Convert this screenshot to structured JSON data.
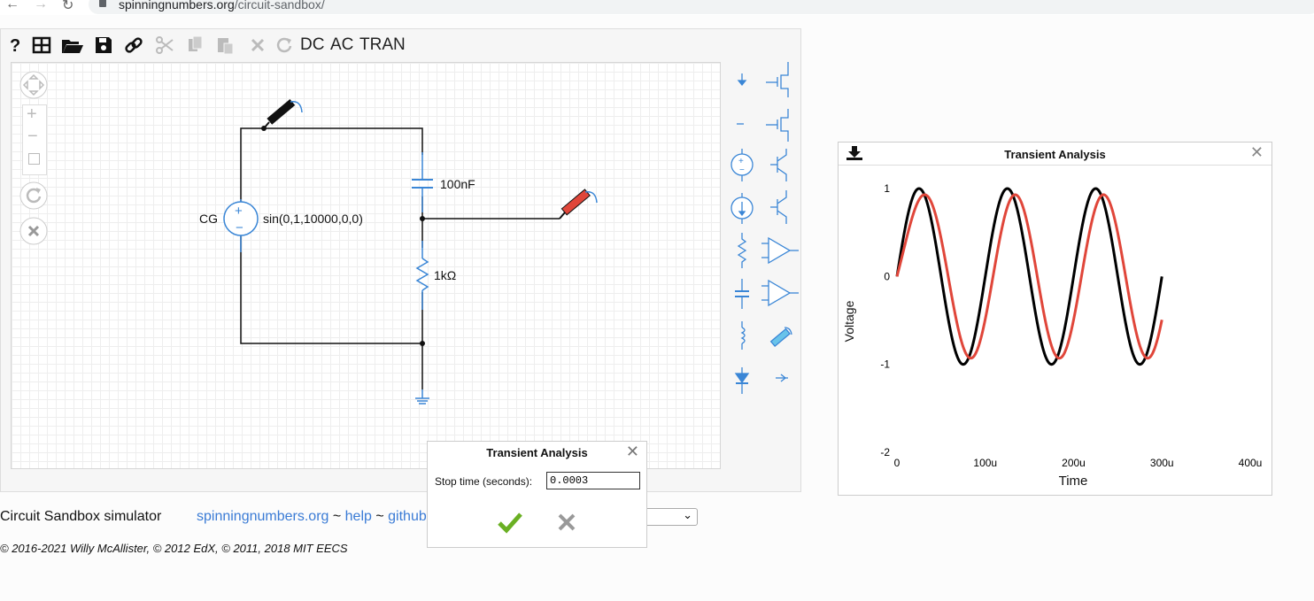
{
  "browser": {
    "url_host": "spinningnumbers.org",
    "url_path": "/circuit-sandbox/"
  },
  "toolbar": {
    "icons": [
      "help-icon",
      "grid-icon",
      "open-folder-icon",
      "save-icon",
      "link-icon",
      "cut-icon",
      "copy-icon",
      "paste-icon",
      "delete-icon",
      "rotate-icon"
    ],
    "dc_label": "DC",
    "ac_label": "AC",
    "tran_label": "TRAN"
  },
  "circuit": {
    "source_name": "CG",
    "source_value": "sin(0,1,10000,0,0)",
    "capacitor_value": "100nF",
    "resistor_value": "1kΩ",
    "probe_colors": [
      "#111111",
      "#e0463a"
    ]
  },
  "parts_bin": [
    "ground",
    "label",
    "voltage-source",
    "current-source",
    "resistor",
    "capacitor",
    "inductor",
    "diode",
    "nmos",
    "pmos",
    "npn",
    "pnp",
    "opamp",
    "opamp-ideal",
    "probe",
    "ammeter"
  ],
  "footer": {
    "title": "Circuit Sandbox simulator",
    "link_site": "spinningnumbers.org",
    "sep1": " ~ ",
    "link_help": "help",
    "sep2": " ~ ",
    "link_github": "github",
    "copyright": "© 2016-2021 Willy McAllister, © 2012 EdX, © 2011, 2018 MIT EECS"
  },
  "dialog": {
    "title": "Transient Analysis",
    "field_label": "Stop time (seconds):",
    "field_value": "0.0003",
    "ok_icon": "checkmark-icon",
    "cancel_icon": "close-icon"
  },
  "plot_window": {
    "title": "Transient Analysis",
    "download_icon": "download-icon",
    "close_icon": "close-icon"
  },
  "chart_data": {
    "type": "line",
    "title": "",
    "xlabel": "Time",
    "ylabel": "Voltage",
    "xlim": [
      0,
      0.0004
    ],
    "ylim": [
      -2,
      1
    ],
    "x_ticks": [
      {
        "v": 0,
        "label": "0"
      },
      {
        "v": 0.0001,
        "label": "100u"
      },
      {
        "v": 0.0002,
        "label": "200u"
      },
      {
        "v": 0.0003,
        "label": "300u"
      },
      {
        "v": 0.0004,
        "label": "400u"
      }
    ],
    "y_ticks": [
      {
        "v": 1,
        "label": "1"
      },
      {
        "v": 0,
        "label": "0"
      },
      {
        "v": -1,
        "label": "-1"
      },
      {
        "v": -2,
        "label": "-2"
      }
    ],
    "series": [
      {
        "color": "#000000",
        "frequency": 10000,
        "amplitude": 1.0,
        "phase_deg": 0,
        "t_end": 0.0003
      },
      {
        "color": "#e0463a",
        "frequency": 10000,
        "amplitude": 0.93,
        "phase_deg": 32,
        "t_end": 0.0003
      }
    ]
  }
}
